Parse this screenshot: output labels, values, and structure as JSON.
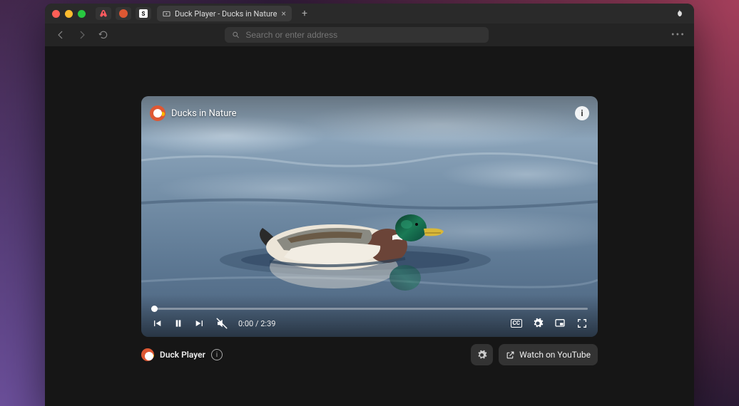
{
  "tabbar": {
    "active_tab": {
      "title": "Duck Player - Ducks in Nature"
    }
  },
  "toolbar": {
    "search_placeholder": "Search or enter address"
  },
  "video": {
    "title": "Ducks in Nature",
    "time_current": "0:00",
    "time_separator": "/",
    "time_total": "2:39",
    "cc_label": "CC"
  },
  "footer": {
    "player_name": "Duck Player",
    "watch_label": "Watch on YouTube"
  }
}
